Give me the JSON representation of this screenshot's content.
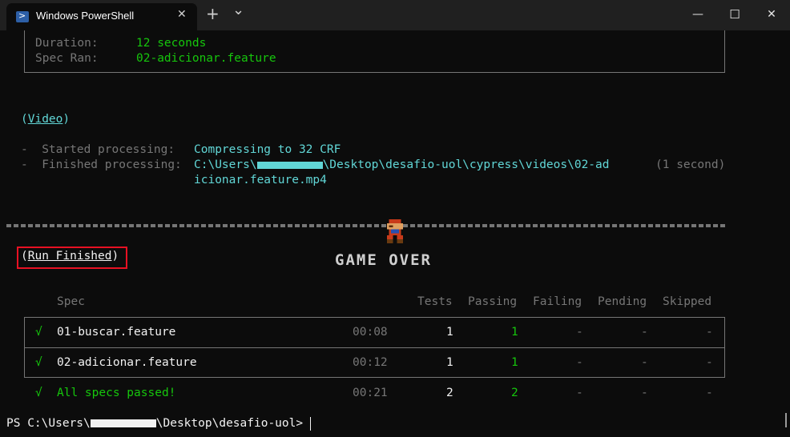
{
  "window": {
    "tab_title": "Windows PowerShell",
    "tab_close": "✕",
    "new_tab": "+",
    "dropdown": "⌄",
    "minimize": "—",
    "maximize": "☐",
    "close": "✕"
  },
  "prev_results": {
    "duration_label": "Duration:",
    "duration_value": "12 seconds",
    "spec_label": "Spec Ran:",
    "spec_value": "02-adicionar.feature"
  },
  "video": {
    "heading_open": "(",
    "heading_link": "Video",
    "heading_close": ")",
    "started_label": "-  Started processing:",
    "started_value": "Compressing to 32 CRF",
    "finished_label": "-  Finished processing:",
    "finished_value_line1_a": "C:\\Users\\",
    "finished_value_line1_b": "\\Desktop\\desafio-uol\\cypress\\videos\\02-ad",
    "finished_value_line2": "icionar.feature.mp4",
    "finished_time": "(1 second)"
  },
  "run": {
    "run_finished_open": "(",
    "run_finished": "Run Finished",
    "run_finished_close": ")",
    "game_over": "GAME OVER"
  },
  "table": {
    "headers": {
      "spec": "Spec",
      "tests": "Tests",
      "passing": "Passing",
      "failing": "Failing",
      "pending": "Pending",
      "skipped": "Skipped"
    },
    "rows": [
      {
        "check": "√",
        "spec": "01-buscar.feature",
        "time": "00:08",
        "tests": "1",
        "passing": "1",
        "failing": "-",
        "pending": "-",
        "skipped": "-"
      },
      {
        "check": "√",
        "spec": "02-adicionar.feature",
        "time": "00:12",
        "tests": "1",
        "passing": "1",
        "failing": "-",
        "pending": "-",
        "skipped": "-"
      }
    ],
    "summary": {
      "check": "√",
      "spec": "All specs passed!",
      "time": "00:21",
      "tests": "2",
      "passing": "2",
      "failing": "-",
      "pending": "-",
      "skipped": "-"
    }
  },
  "prompt": {
    "prefix": "PS C:\\Users\\",
    "suffix": "\\Desktop\\desafio-uol>"
  }
}
